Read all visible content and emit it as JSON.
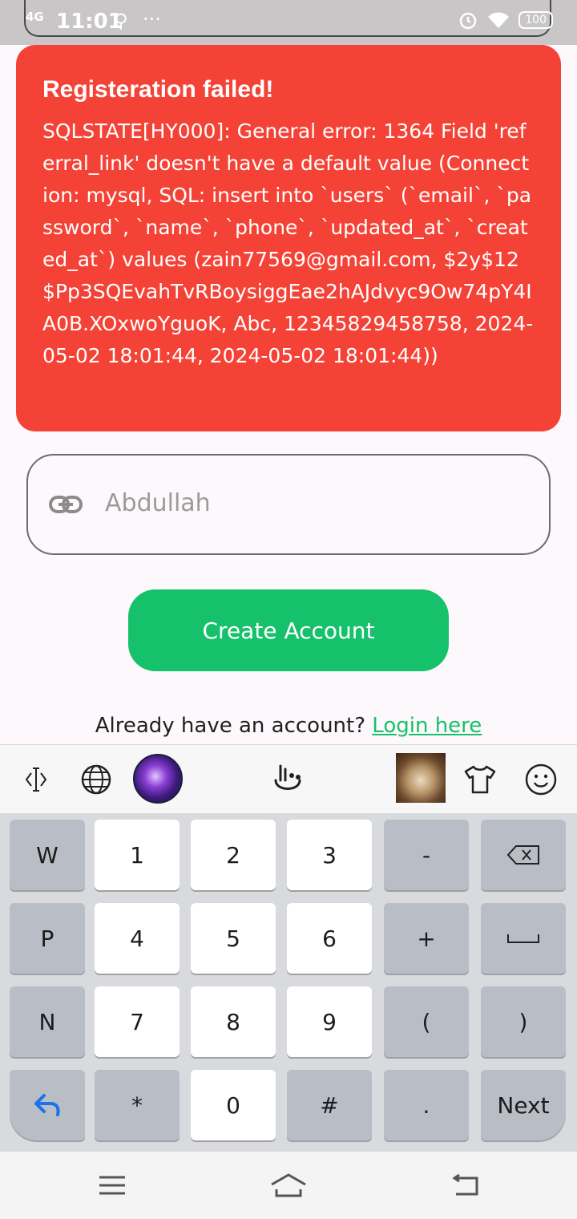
{
  "status_bar": {
    "network": "4G",
    "time": "11:01",
    "usb_icon": "usb-icon",
    "more": "···",
    "alarm_icon": "alarm-icon",
    "wifi_icon": "wifi-icon",
    "battery": "100"
  },
  "error": {
    "title": "Registeration failed!",
    "message": "SQLSTATE[HY000]: General error: 1364 Field 'referral_link' doesn't have a default value (Connection: mysql, SQL: insert into `users` (`email`, `password`, `name`, `phone`, `updated_at`, `created_at`) values (zain77569@gmail.com, $2y$12$Pp3SQEvahTvRBoysiggEae2hAJdvyc9Ow74pY4IA0B.XOxwoYguoK, Abc, 12345829458758, 2024-05-02 18:01:44, 2024-05-02 18:01:44))"
  },
  "referral_field": {
    "icon": "link-icon",
    "value": "Abdullah"
  },
  "create_button": "Create Account",
  "login_prompt": {
    "text": "Already have an account?",
    "link": "Login here"
  },
  "colors": {
    "error": "#f44336",
    "accent": "#15c16b"
  },
  "keyboard": {
    "toolbar": [
      "cursor-icon",
      "globe-icon",
      "theme-galaxy-icon",
      "gesture-icon",
      "sticker-photo-icon",
      "tshirt-icon",
      "emoji-icon"
    ],
    "rows": [
      [
        "W",
        "1",
        "2",
        "3",
        "-",
        "⌫"
      ],
      [
        "P",
        "4",
        "5",
        "6",
        "+",
        "␣"
      ],
      [
        "N",
        "7",
        "8",
        "9",
        "(",
        ")"
      ],
      [
        "↶",
        "*",
        "0",
        "#",
        ".",
        "Next"
      ]
    ]
  },
  "nav": [
    "menu-icon",
    "home-icon",
    "back-icon"
  ]
}
